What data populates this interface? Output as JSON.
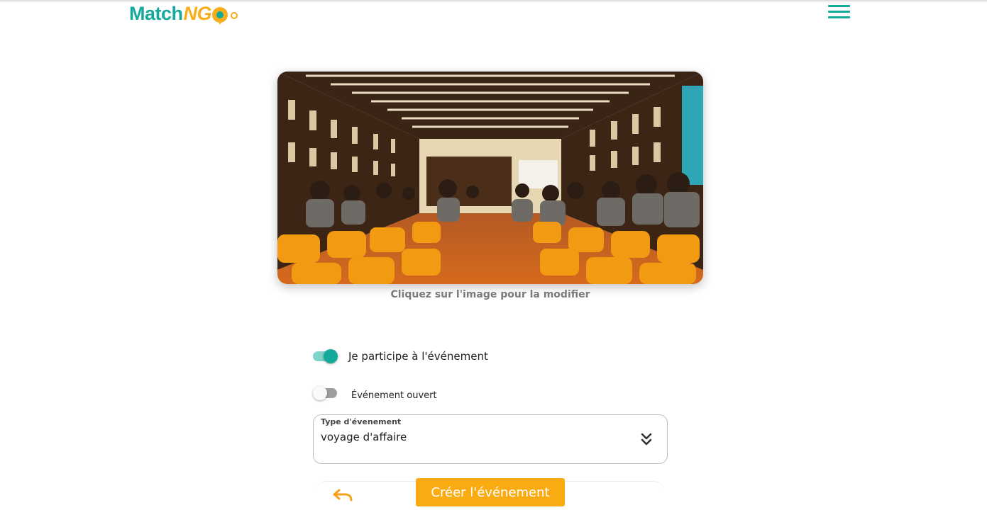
{
  "header": {
    "logo_text_1": "Match",
    "logo_text_2": "NG",
    "menu_icon": "hamburger-menu-icon"
  },
  "event_image": {
    "hint": "Cliquez sur l'image pour la modifier"
  },
  "form": {
    "participate_label": "Je participe à l'événement",
    "participate_on": true,
    "open_label": "Événement ouvert",
    "open_on": false,
    "type_label": "Type d'évenement",
    "type_value": "voyage d'affaire"
  },
  "footer": {
    "undo_icon": "undo-icon",
    "create_label": "Créer l'événement"
  },
  "colors": {
    "brand_teal": "#14a99b",
    "brand_orange": "#fbab12"
  }
}
